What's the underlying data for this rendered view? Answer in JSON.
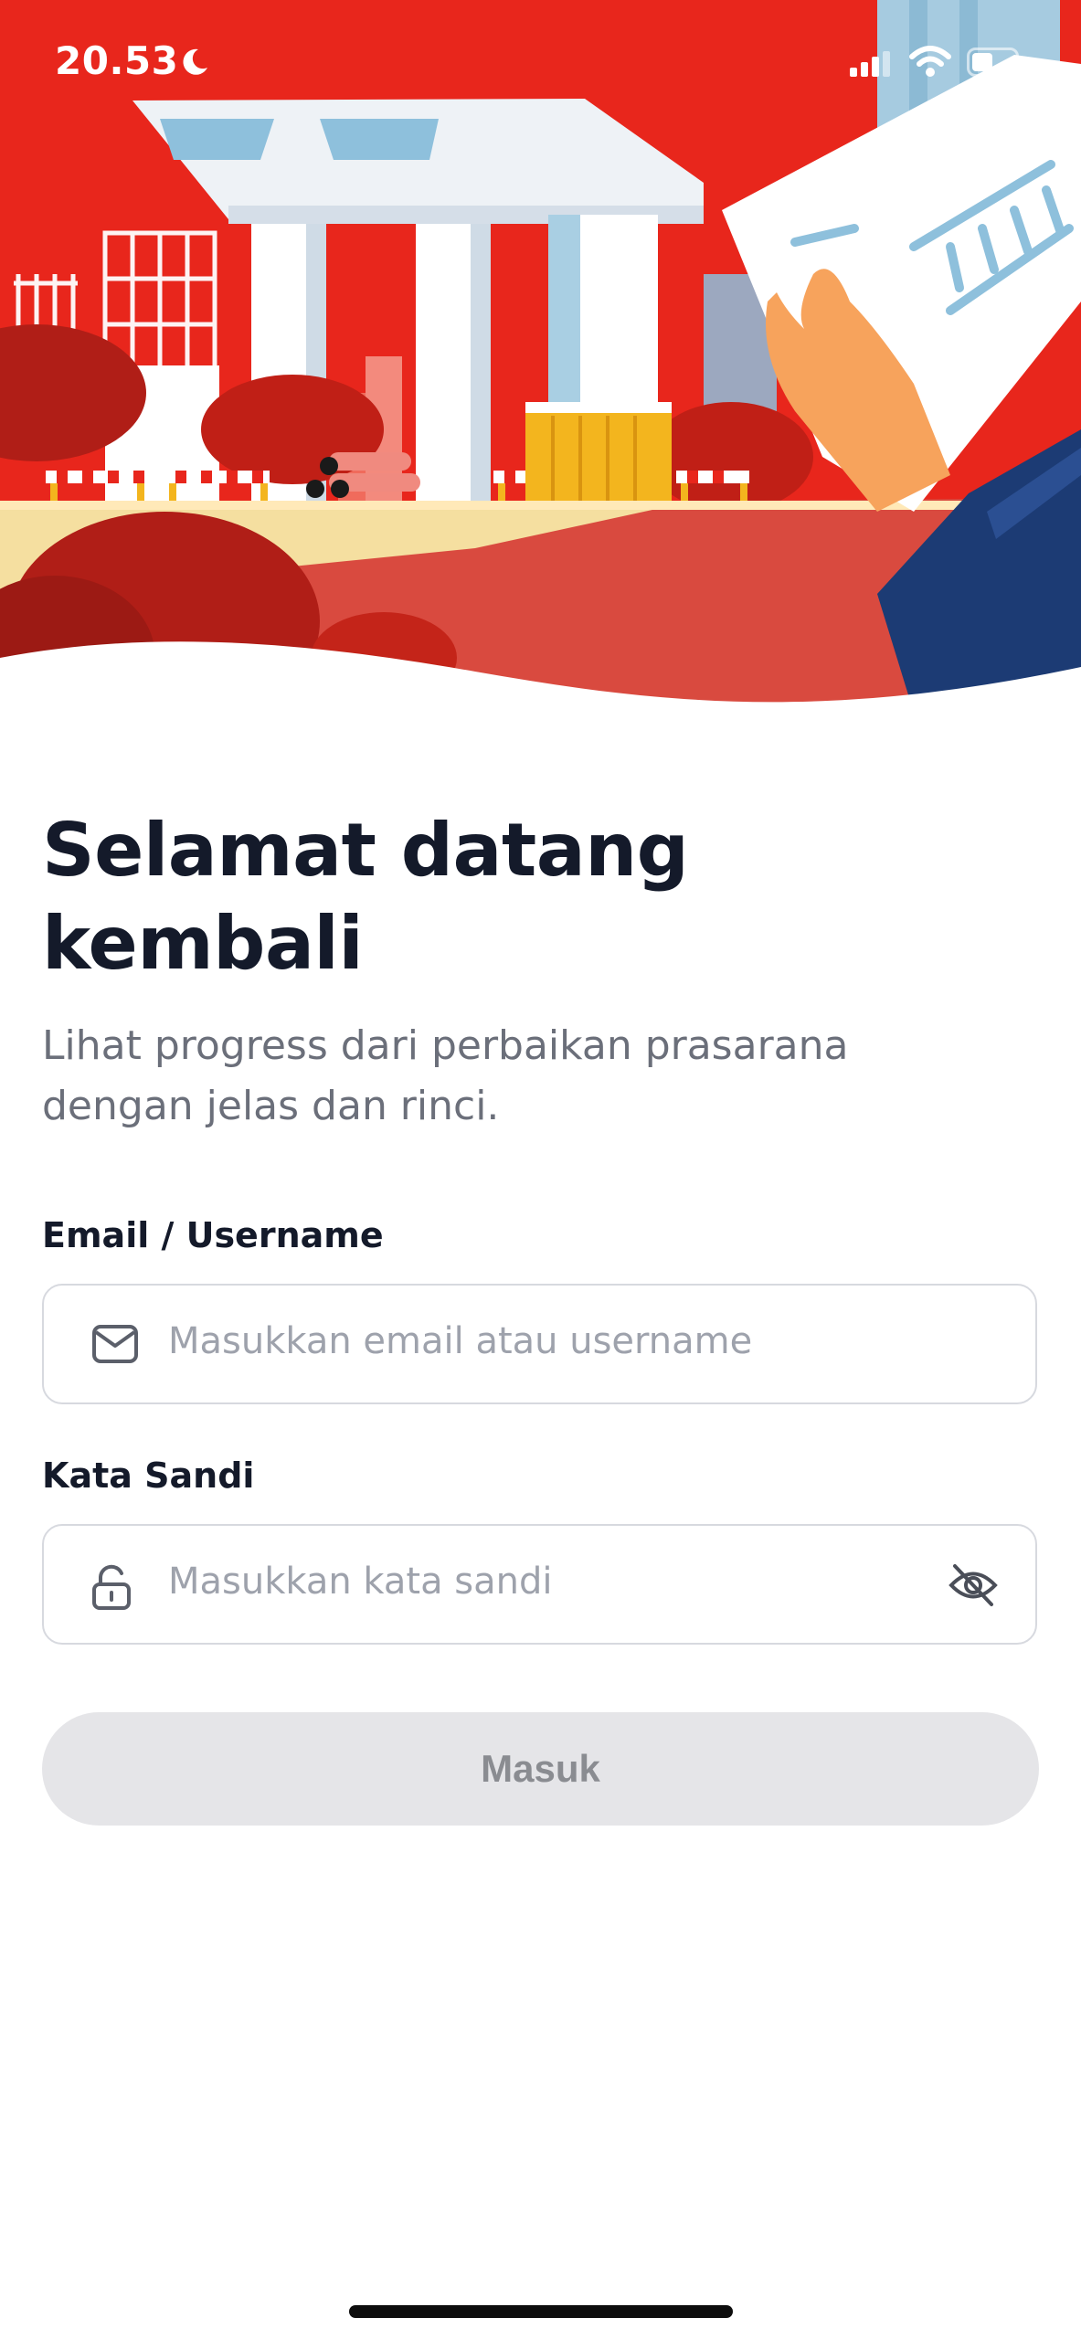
{
  "status_bar": {
    "time": "20.53"
  },
  "welcome": {
    "title_line1": "Selamat datang",
    "title_line2": "kembali",
    "subtitle": "Lihat progress dari perbaikan prasarana dengan jelas dan rinci."
  },
  "form": {
    "email_label": "Email / Username",
    "email_placeholder": "Masukkan email atau username",
    "password_label": "Kata Sandi",
    "password_placeholder": "Masukkan kata sandi",
    "submit_label": "Masuk"
  },
  "colors": {
    "hero_red": "#e8261c",
    "title": "#141a2a",
    "button_disabled_bg": "#e5e5e8",
    "button_disabled_text": "#8a8c91"
  },
  "icons": {
    "email": "mail-icon",
    "password": "lock-icon",
    "toggle": "eye-off-icon"
  }
}
